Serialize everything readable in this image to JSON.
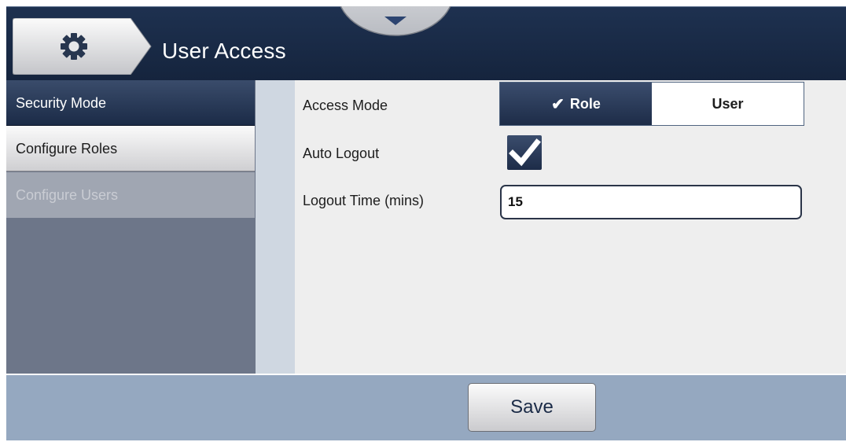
{
  "header": {
    "title": "User Access",
    "home_icon": "gear-icon",
    "pull_tab_icon": "caret-down-icon"
  },
  "sidebar": {
    "items": [
      {
        "label": "Security Mode",
        "state": "selected"
      },
      {
        "label": "Configure Roles",
        "state": "enabled"
      },
      {
        "label": "Configure Users",
        "state": "disabled"
      }
    ]
  },
  "form": {
    "access_mode": {
      "label": "Access Mode",
      "options": [
        "Role",
        "User"
      ],
      "selected": "Role",
      "check_glyph": "✔"
    },
    "auto_logout": {
      "label": "Auto Logout",
      "checked": true
    },
    "logout_time": {
      "label": "Logout Time (mins)",
      "value": "15"
    }
  },
  "footer": {
    "save_label": "Save"
  },
  "colors": {
    "header_bg": "#1a2b47",
    "selected_bg": "#26395a",
    "sidebar_bg": "#6d7689",
    "content_bg": "#eeeeee",
    "footer_bg": "#95a8c0"
  }
}
